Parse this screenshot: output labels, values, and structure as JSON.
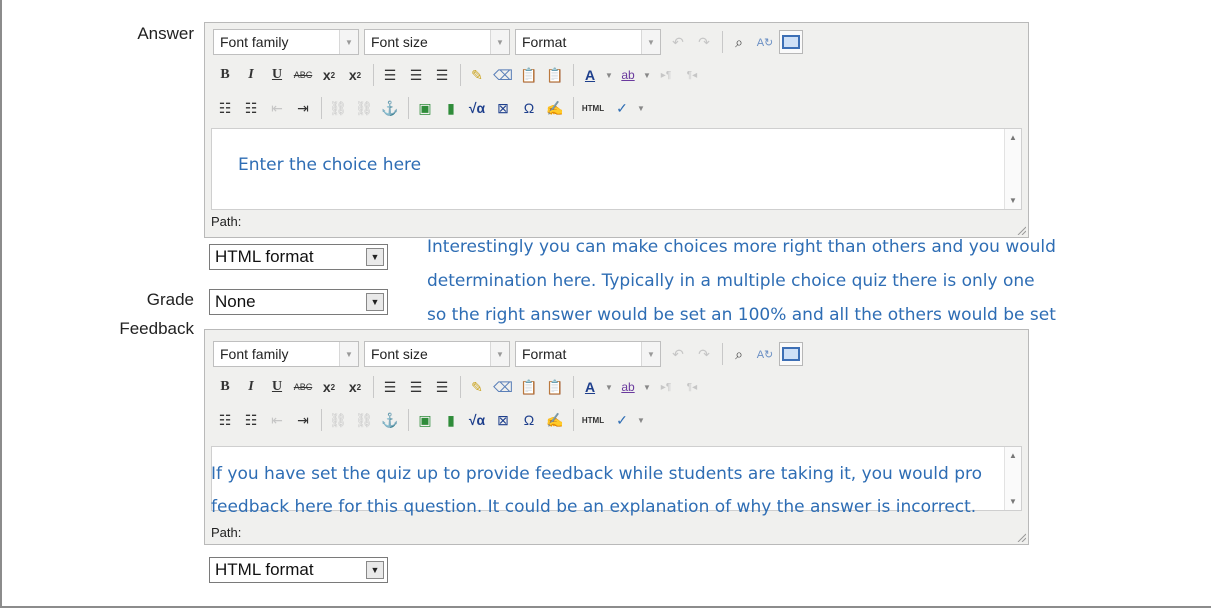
{
  "labels": {
    "answer": "Answer",
    "grade": "Grade",
    "feedback": "Feedback"
  },
  "toolbar": {
    "font_family": "Font family",
    "font_size": "Font size",
    "format": "Format",
    "html_badge": "HTML"
  },
  "answer_editor": {
    "content": "Enter the choice here",
    "path_label": "Path:",
    "format_select": "HTML format"
  },
  "grade": {
    "selected": "None"
  },
  "feedback_editor": {
    "path_label": "Path:",
    "format_select": "HTML format"
  },
  "notes": {
    "grade_note_line1": "Interestingly you can make choices more right than others and you would",
    "grade_note_line2": "determination here.  Typically in a multiple choice quiz there is only one",
    "grade_note_line3": "so the right answer would be set an 100% and all the others would be set",
    "feedback_note_line1": "If you have set the quiz up to provide feedback while students are taking it, you would pro",
    "feedback_note_line2": "feedback here for this question.  It could be an explanation of why the answer is incorrect."
  },
  "colors": {
    "note_text": "#2e6db4",
    "editor_bg": "#f0f0ee"
  },
  "icons": [
    "undo-icon",
    "redo-icon",
    "find-icon",
    "replace-icon",
    "fullscreen-icon",
    "bold-icon",
    "italic-icon",
    "underline-icon",
    "strikethrough-icon",
    "subscript-icon",
    "superscript-icon",
    "align-left-icon",
    "align-center-icon",
    "align-right-icon",
    "cleanup-icon",
    "eraser-icon",
    "paste-text-icon",
    "paste-word-icon",
    "text-color-icon",
    "highlight-icon",
    "ltr-icon",
    "rtl-icon",
    "bullet-list-icon",
    "numbered-list-icon",
    "outdent-icon",
    "indent-icon",
    "link-icon",
    "unlink-icon",
    "anchor-icon",
    "image-icon",
    "media-icon",
    "equation-icon",
    "nolink-icon",
    "special-char-icon",
    "emoticon-icon",
    "html-source-icon",
    "spellcheck-icon"
  ]
}
